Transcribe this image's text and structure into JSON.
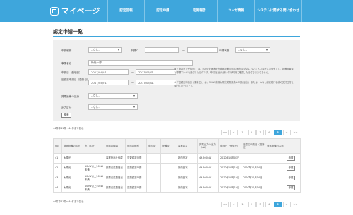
{
  "header": {
    "app_title": "マイページ",
    "nav": [
      {
        "label": "認定回報"
      },
      {
        "label": "認定申請"
      },
      {
        "label": "定期報告"
      },
      {
        "label": "ユーザ情報"
      },
      {
        "label": "システムに関する問い合わせ"
      }
    ]
  },
  "page": {
    "title": "認定申請一覧"
  },
  "filters": {
    "row1": {
      "label_a": "申請種別",
      "value_a": "--なし--",
      "label_b": "申請ID",
      "tilde": "～",
      "label_c": "申請状態",
      "value_c": "--なし--"
    },
    "row2": {
      "label": "事業者名",
      "value": "新仕一郎"
    },
    "row3": {
      "label_a": "申請日（受領日）",
      "from_a": "2017/04/01",
      "to_a": "2017/05/01",
      "label_b": "旧認定申請日（更新日）",
      "from_b": "2017/04/01",
      "to_b": "2017/05/01",
      "tilde": "～",
      "note_1": "※「申請日（受領日）」は、50kW未満太陽光発電設備の申請(届出)の内容について入力者が入力を完了し、設備設置者と事業コードを送付した日付です。申請(届出)を受け付け時刻に確認した日付ではありません。",
      "note_2": "※「旧認定申請日（更新日）」は、50kW未満太陽光発電設備の申請(届出)、または、みなし認定移行手続の受付日付を発行した日付です。"
    },
    "row4": {
      "label": "発電設備の区分",
      "value": "--なし--"
    },
    "row5": {
      "label": "出力区分",
      "value": "--なし--"
    },
    "search_button": "検索"
  },
  "results": {
    "count_text_top": "44件中41件～44件まで表示",
    "count_text_bottom": "44件中41件～44件まで表示",
    "pager": [
      "<<",
      "<",
      "1",
      "2",
      "3",
      "4",
      "5",
      ">",
      ">>"
    ],
    "active_page": "5",
    "columns": [
      "No",
      "発電設備の区分",
      "出力区分",
      "申請の種類",
      "申請の種別",
      "申請ID",
      "設備ID",
      "事業者名",
      "発電出力の出力（kW）",
      "申請日（受領日）",
      "旧認定申請日（更新日）",
      "発電設備の名称",
      ""
    ],
    "rows": [
      {
        "no": "41",
        "kubun": "太陽光",
        "output": "",
        "shurui": "事業計画を作成",
        "shubetsu": "変更認定申請",
        "id": "",
        "setsubi": "",
        "name": "新内田次",
        "kw": "49.500kW",
        "date1": "2020年10月01日",
        "date2": "",
        "facility": "",
        "btn": "参照"
      },
      {
        "no": "42",
        "kubun": "太陽光",
        "output": "10kW以上50kW未満",
        "shurui": "設置者変更届出",
        "shubetsu": "変更認定申請",
        "id": "",
        "setsubi": "",
        "name": "新内田次",
        "kw": "49.500kW",
        "date1": "2020年10月14日",
        "date2": "2020年10月14日",
        "facility": "",
        "btn": "参照"
      },
      {
        "no": "43",
        "kubun": "太陽光",
        "output": "10kW以上50kW未満",
        "shurui": "設置者変更届出",
        "shubetsu": "変更認定申請",
        "id": "",
        "setsubi": "",
        "name": "新内田次",
        "kw": "49.500kW",
        "date1": "2020年10月14日",
        "date2": "2020年10月14日",
        "facility": "",
        "btn": "参照"
      },
      {
        "no": "44",
        "kubun": "太陽光",
        "output": "10kW以上50kW未満",
        "shurui": "設置者変更届出",
        "shubetsu": "変更認定申請",
        "id": "",
        "setsubi": "",
        "name": "新内田次",
        "kw": "49.500kW",
        "date1": "2020年10月14日",
        "date2": "2020年10月14日",
        "facility": "",
        "btn": "参照"
      }
    ]
  },
  "colors": {
    "accent": "#3ea6dc",
    "panel": "#efefef"
  }
}
